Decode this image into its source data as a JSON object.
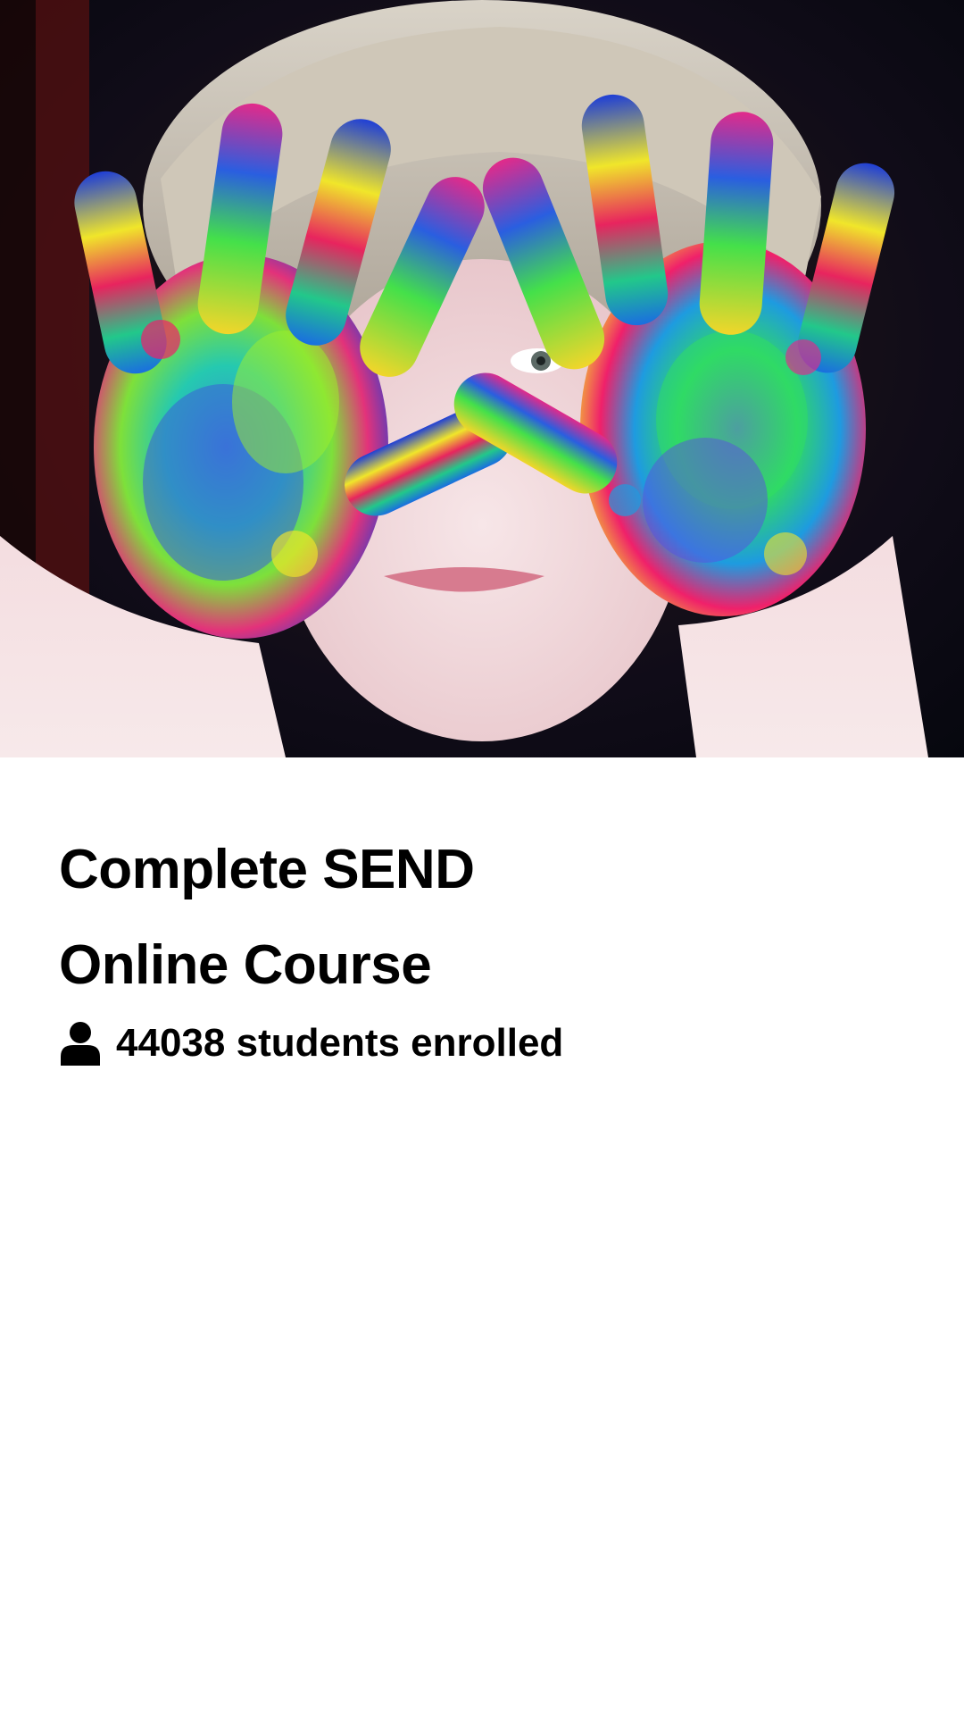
{
  "hero": {
    "image_subject": "child-with-colorful-painted-hands"
  },
  "course": {
    "title_line1": "Complete SEND",
    "title_line2": "Online Course",
    "enrolled_count": "44038",
    "enrolled_suffix": "students enrolled",
    "enrolled_icon": "person-icon"
  },
  "colors": {
    "background": "#ffffff",
    "text": "#000000"
  }
}
